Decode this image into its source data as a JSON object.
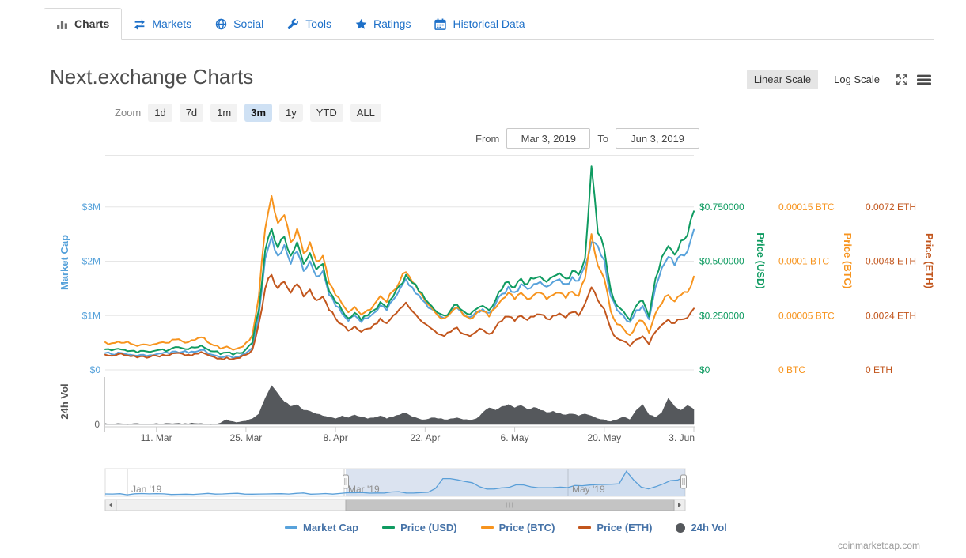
{
  "tabs": [
    {
      "label": "Charts",
      "icon": "bar-chart-icon",
      "active": true
    },
    {
      "label": "Markets",
      "icon": "exchange-arrows-icon",
      "active": false
    },
    {
      "label": "Social",
      "icon": "globe-icon",
      "active": false
    },
    {
      "label": "Tools",
      "icon": "wrench-icon",
      "active": false
    },
    {
      "label": "Ratings",
      "icon": "star-icon",
      "active": false
    },
    {
      "label": "Historical Data",
      "icon": "calendar-icon",
      "active": false
    }
  ],
  "header": {
    "title": "Next.exchange Charts",
    "scale_linear": "Linear Scale",
    "scale_log": "Log Scale"
  },
  "zoom_controls": {
    "label": "Zoom",
    "buttons": [
      "1d",
      "7d",
      "1m",
      "3m",
      "1y",
      "YTD",
      "ALL"
    ],
    "active": "3m"
  },
  "date_range": {
    "from_label": "From",
    "from_value": "Mar 3, 2019",
    "to_label": "To",
    "to_value": "Jun 3, 2019"
  },
  "chart_data": {
    "type": "line",
    "title": "Next.exchange Charts",
    "start_date": "Mar 3, 2019",
    "end_date": "Jun 3, 2019",
    "value_scale_note": "values in $M on Market Cap axis; all four axes share aligned gridlines ($1M = $0.25 = 0.00005 BTC = 0.0024 ETH)",
    "x_tick_labels": [
      "11. Mar",
      "25. Mar",
      "8. Apr",
      "22. Apr",
      "6. May",
      "20. May",
      "3. Jun"
    ],
    "x_tick_days": [
      8,
      22,
      36,
      50,
      64,
      78,
      92
    ],
    "axis_row_values": [
      3,
      2,
      1,
      0
    ],
    "axes": [
      {
        "title": "Market Cap",
        "side": "left",
        "color": "#55a1da",
        "tick_labels": [
          "$3M",
          "$2M",
          "$1M",
          "$0"
        ]
      },
      {
        "title": "Price (USD)",
        "side": "right",
        "color": "#0f9b61",
        "tick_labels": [
          "$0.750000",
          "$0.500000",
          "$0.250000",
          "$0"
        ]
      },
      {
        "title": "Price (BTC)",
        "side": "right",
        "color": "#f7941e",
        "tick_labels": [
          "0.00015 BTC",
          "0.0001 BTC",
          "0.00005 BTC",
          "0 BTC"
        ]
      },
      {
        "title": "Price (ETH)",
        "side": "right",
        "color": "#c2561d",
        "tick_labels": [
          "0.0072 ETH",
          "0.0048 ETH",
          "0.0024 ETH",
          "0 ETH"
        ]
      }
    ],
    "series": [
      {
        "name": "Market Cap",
        "color": "#58a2db",
        "values": [
          0.31,
          0.29,
          0.32,
          0.3,
          0.28,
          0.26,
          0.28,
          0.27,
          0.29,
          0.31,
          0.3,
          0.34,
          0.33,
          0.31,
          0.33,
          0.37,
          0.31,
          0.27,
          0.23,
          0.26,
          0.22,
          0.25,
          0.31,
          0.41,
          1.0,
          2.05,
          2.45,
          2.1,
          2.3,
          1.95,
          2.18,
          1.82,
          2.0,
          1.72,
          1.82,
          1.38,
          1.18,
          1.04,
          0.9,
          1.0,
          0.88,
          0.95,
          1.05,
          1.19,
          1.1,
          1.29,
          1.48,
          1.67,
          1.52,
          1.38,
          1.24,
          1.12,
          1.0,
          0.95,
          1.05,
          1.14,
          1.03,
          0.97,
          1.07,
          1.12,
          1.05,
          1.21,
          1.4,
          1.53,
          1.43,
          1.58,
          1.49,
          1.58,
          1.62,
          1.53,
          1.62,
          1.67,
          1.58,
          1.71,
          1.64,
          1.92,
          2.35,
          2.28,
          2.02,
          1.36,
          1.1,
          1.0,
          0.88,
          1.1,
          1.18,
          0.93,
          1.52,
          1.88,
          2.08,
          1.92,
          2.12,
          2.18,
          2.58
        ]
      },
      {
        "name": "Price (USD)",
        "color": "#0f9b61",
        "values": [
          0.38,
          0.36,
          0.39,
          0.37,
          0.35,
          0.32,
          0.35,
          0.33,
          0.36,
          0.38,
          0.37,
          0.42,
          0.4,
          0.38,
          0.41,
          0.45,
          0.38,
          0.34,
          0.29,
          0.32,
          0.28,
          0.31,
          0.38,
          0.5,
          1.1,
          2.2,
          2.6,
          2.25,
          2.45,
          2.1,
          2.35,
          1.95,
          2.15,
          1.85,
          1.95,
          1.45,
          1.25,
          1.1,
          0.95,
          1.05,
          0.92,
          1.0,
          1.1,
          1.25,
          1.15,
          1.35,
          1.55,
          1.75,
          1.6,
          1.45,
          1.3,
          1.18,
          1.05,
          1.0,
          1.1,
          1.2,
          1.08,
          1.02,
          1.12,
          1.18,
          1.1,
          1.28,
          1.48,
          1.62,
          1.52,
          1.68,
          1.58,
          1.68,
          1.72,
          1.62,
          1.72,
          1.78,
          1.68,
          1.82,
          1.75,
          2.05,
          3.75,
          2.52,
          2.22,
          1.48,
          1.18,
          1.08,
          0.92,
          1.18,
          1.28,
          0.98,
          1.68,
          2.08,
          2.28,
          2.12,
          2.38,
          2.48,
          2.92
        ]
      },
      {
        "name": "Price (BTC)",
        "color": "#f7941e",
        "values": [
          0.51,
          0.49,
          0.52,
          0.5,
          0.48,
          0.44,
          0.47,
          0.45,
          0.48,
          0.51,
          0.5,
          0.56,
          0.53,
          0.51,
          0.55,
          0.6,
          0.51,
          0.45,
          0.39,
          0.43,
          0.37,
          0.41,
          0.5,
          0.64,
          1.35,
          2.6,
          3.2,
          2.7,
          2.85,
          2.35,
          2.6,
          2.15,
          2.35,
          2.0,
          2.1,
          1.6,
          1.38,
          1.22,
          1.06,
          1.16,
          1.02,
          1.1,
          1.2,
          1.36,
          1.25,
          1.45,
          1.62,
          1.8,
          1.62,
          1.45,
          1.28,
          1.15,
          1.0,
          0.95,
          1.05,
          1.15,
          1.0,
          0.94,
          1.04,
          1.08,
          0.98,
          1.14,
          1.3,
          1.42,
          1.3,
          1.42,
          1.3,
          1.38,
          1.42,
          1.3,
          1.38,
          1.42,
          1.32,
          1.44,
          1.36,
          1.68,
          2.5,
          1.92,
          1.68,
          1.08,
          0.84,
          0.76,
          0.64,
          0.84,
          0.9,
          0.68,
          1.04,
          1.22,
          1.38,
          1.26,
          1.38,
          1.43,
          1.72
        ]
      },
      {
        "name": "Price (ETH)",
        "color": "#c2561d",
        "values": [
          0.28,
          0.26,
          0.29,
          0.27,
          0.25,
          0.23,
          0.25,
          0.24,
          0.26,
          0.28,
          0.27,
          0.31,
          0.3,
          0.28,
          0.3,
          0.33,
          0.28,
          0.24,
          0.21,
          0.23,
          0.2,
          0.22,
          0.28,
          0.37,
          0.85,
          1.5,
          1.75,
          1.5,
          1.62,
          1.42,
          1.58,
          1.35,
          1.48,
          1.28,
          1.35,
          1.1,
          0.95,
          0.84,
          0.72,
          0.8,
          0.7,
          0.76,
          0.84,
          0.95,
          0.86,
          1.0,
          1.12,
          1.24,
          1.08,
          0.95,
          0.85,
          0.76,
          0.66,
          0.62,
          0.7,
          0.78,
          0.66,
          0.62,
          0.7,
          0.74,
          0.66,
          0.78,
          0.9,
          0.98,
          0.9,
          1.0,
          0.92,
          0.98,
          1.02,
          0.94,
          1.0,
          1.04,
          0.96,
          1.06,
          1.0,
          1.22,
          1.52,
          1.28,
          1.12,
          0.76,
          0.58,
          0.53,
          0.44,
          0.56,
          0.62,
          0.47,
          0.7,
          0.83,
          0.93,
          0.86,
          0.93,
          0.96,
          1.13
        ]
      }
    ],
    "volume": {
      "name": "24h Vol",
      "axis_title": "24h Vol",
      "zero_label": "0",
      "color": "#55585c",
      "values": [
        0.02,
        0.01,
        0.02,
        0.01,
        0.01,
        0.02,
        0.01,
        0.01,
        0.02,
        0.01,
        0.02,
        0.02,
        0.01,
        0.01,
        0.02,
        0.02,
        0.01,
        0.01,
        0.03,
        0.1,
        0.06,
        0.05,
        0.07,
        0.12,
        0.22,
        0.55,
        0.82,
        0.65,
        0.48,
        0.38,
        0.42,
        0.3,
        0.28,
        0.22,
        0.18,
        0.15,
        0.12,
        0.18,
        0.14,
        0.2,
        0.16,
        0.12,
        0.14,
        0.18,
        0.12,
        0.16,
        0.2,
        0.24,
        0.16,
        0.12,
        0.1,
        0.14,
        0.12,
        0.1,
        0.12,
        0.14,
        0.1,
        0.08,
        0.12,
        0.25,
        0.35,
        0.3,
        0.38,
        0.42,
        0.35,
        0.4,
        0.32,
        0.36,
        0.3,
        0.25,
        0.28,
        0.24,
        0.2,
        0.22,
        0.18,
        0.22,
        0.18,
        0.12,
        0.1,
        0.06,
        0.1,
        0.16,
        0.1,
        0.3,
        0.42,
        0.2,
        0.15,
        0.25,
        0.55,
        0.38,
        0.3,
        0.4,
        0.32
      ]
    },
    "navigator": {
      "month_labels": [
        "Jan '19",
        "Mar '19",
        "May '19"
      ],
      "line_color": "#5a9fd8",
      "values": [
        0.07,
        0.07,
        0.08,
        0.07,
        0.08,
        0.09,
        0.1,
        0.12,
        0.1,
        0.09,
        0.09,
        0.08,
        0.09,
        0.09,
        0.1,
        0.09,
        0.09,
        0.1,
        0.09,
        0.1,
        0.1,
        0.09,
        0.1,
        0.1,
        0.11,
        0.1,
        0.1,
        0.11,
        0.1,
        0.11,
        0.11,
        0.1,
        0.11,
        0.14,
        0.14,
        0.13,
        0.13,
        0.14,
        0.14,
        0.15,
        0.15,
        0.14,
        0.12,
        0.12,
        0.14,
        0.31,
        0.67,
        0.64,
        0.61,
        0.57,
        0.52,
        0.35,
        0.28,
        0.27,
        0.31,
        0.33,
        0.42,
        0.43,
        0.36,
        0.3,
        0.31,
        0.31,
        0.32,
        0.31,
        0.41,
        0.41,
        0.43,
        0.46,
        0.46,
        0.45,
        0.47,
        0.95,
        0.58,
        0.33,
        0.27,
        0.36,
        0.45,
        0.6,
        0.62,
        0.75
      ]
    },
    "grid": true,
    "legend_position": "bottom"
  },
  "legend": [
    {
      "label": "Market Cap",
      "color": "#58a2db",
      "marker": "line"
    },
    {
      "label": "Price (USD)",
      "color": "#0f9b61",
      "marker": "line"
    },
    {
      "label": "Price (BTC)",
      "color": "#f7941e",
      "marker": "line"
    },
    {
      "label": "Price (ETH)",
      "color": "#c2561d",
      "marker": "line"
    },
    {
      "label": "24h Vol",
      "color": "#55585c",
      "marker": "circle"
    }
  ],
  "footer": {
    "credit": "coinmarketcap.com"
  }
}
